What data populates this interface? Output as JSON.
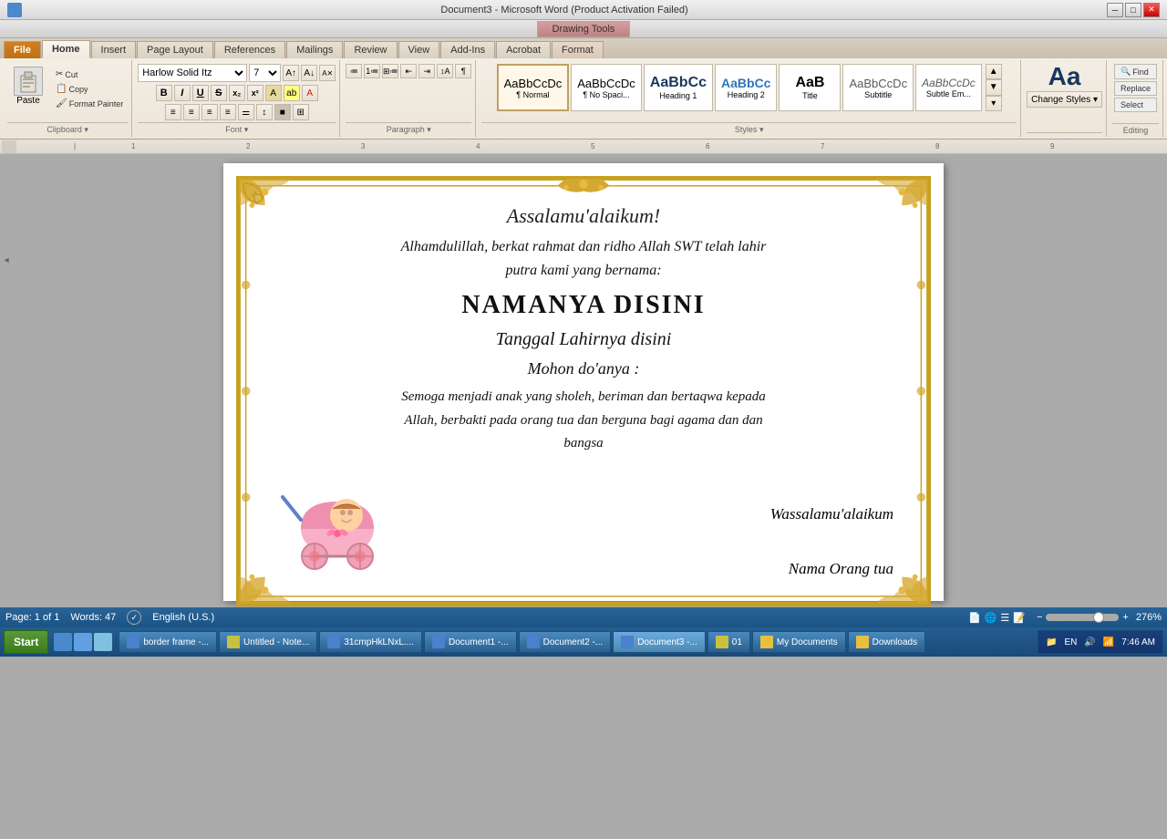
{
  "titleBar": {
    "title": "Document3 - Microsoft Word (Product Activation Failed)",
    "drawingTools": "Drawing Tools",
    "controls": [
      "─",
      "□",
      "✕"
    ]
  },
  "ribbon": {
    "tabs": [
      "File",
      "Home",
      "Insert",
      "Page Layout",
      "References",
      "Mailings",
      "Review",
      "View",
      "Add-Ins",
      "Acrobat",
      "Format"
    ],
    "activeTab": "Home",
    "clipboard": {
      "paste": "Paste",
      "cut": "Cut",
      "copy": "Copy",
      "formatPainter": "Format Painter"
    },
    "font": {
      "name": "Harlow Solid Itz",
      "size": "7",
      "bold": "B",
      "italic": "I",
      "underline": "U",
      "strikethrough": "S",
      "subscript": "x₂",
      "superscript": "x²"
    },
    "styles": [
      {
        "label": "Normal",
        "sublabel": "¶ Normal"
      },
      {
        "label": "No Spaci...",
        "sublabel": "¶ No Spaci..."
      },
      {
        "label": "Heading 1",
        "sublabel": "Heading 1"
      },
      {
        "label": "Heading 2",
        "sublabel": "Heading 2"
      },
      {
        "label": "Title",
        "sublabel": "Title"
      },
      {
        "label": "Subtitle",
        "sublabel": "Subtitle"
      },
      {
        "label": "Subtle Em...",
        "sublabel": "Subtle Em..."
      }
    ],
    "editing": {
      "find": "Find",
      "replace": "Replace",
      "select": "Select"
    }
  },
  "document": {
    "invitation": {
      "greeting": "Assalamu'alaikum!",
      "line1": "Alhamdulillah, berkat rahmat dan ridho Allah SWT telah lahir",
      "line2": "putra kami yang bernama:",
      "name": "NAMANYA DISINI",
      "date": "Tanggal Lahirnya disini",
      "prayerTitle": "Mohon do'anya :",
      "prayer1": "Semoga menjadi anak yang sholeh, beriman dan bertaqwa kepada",
      "prayer2": "Allah, berbakti pada orang tua dan berguna bagi agama dan dan",
      "prayer3": "bangsa",
      "closing": "Wassalamu'alaikum",
      "parentLabel": "Nama Orang tua"
    }
  },
  "statusBar": {
    "page": "Page: 1 of 1",
    "words": "Words: 47",
    "language": "English (U.S.)",
    "zoom": "276%"
  },
  "taskbar": {
    "start": "Start",
    "tasks": [
      {
        "label": "border frame -...",
        "icon": "blue"
      },
      {
        "label": "Untitled - Note...",
        "icon": "yellow"
      },
      {
        "label": "31cmpHkLNxL....",
        "icon": "blue"
      },
      {
        "label": "Document1 -...",
        "icon": "blue"
      },
      {
        "label": "Document2 -...",
        "icon": "blue"
      },
      {
        "label": "Document3 -...",
        "icon": "blue",
        "active": true
      },
      {
        "label": "01",
        "icon": "yellow"
      },
      {
        "label": "My Documents",
        "icon": "folder"
      },
      {
        "label": "Downloads",
        "icon": "folder"
      }
    ],
    "tray": {
      "time": "7:46 AM",
      "icons": [
        "EN",
        "🔊",
        "📶"
      ]
    }
  }
}
